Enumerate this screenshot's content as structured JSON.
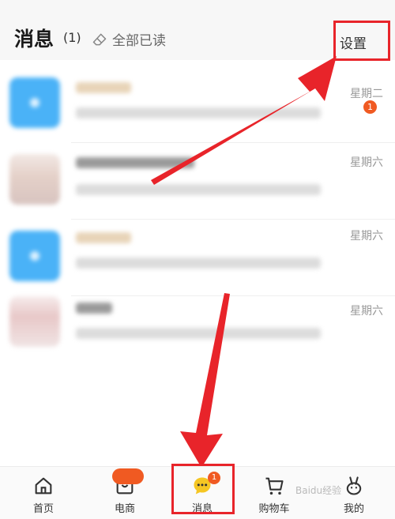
{
  "header": {
    "title": "消息",
    "count": "(1)",
    "mark_all_read": "全部已读",
    "settings": "设置"
  },
  "messages": [
    {
      "time": "星期二",
      "badge": "1"
    },
    {
      "time": "星期六",
      "badge": ""
    },
    {
      "time": "星期六",
      "badge": ""
    },
    {
      "time": "星期六",
      "badge": ""
    }
  ],
  "tabs": [
    {
      "label": "首页",
      "icon": "home-icon"
    },
    {
      "label": "电商",
      "icon": "shop-icon"
    },
    {
      "label": "消息",
      "icon": "message-icon",
      "badge": "1"
    },
    {
      "label": "购物车",
      "icon": "cart-icon"
    },
    {
      "label": "我的",
      "icon": "profile-icon"
    }
  ],
  "watermark": "Baidu经验",
  "colors": {
    "annotation_red": "#e8242a",
    "badge_orange": "#f05a22",
    "message_yellow": "#f5c623",
    "avatar_blue": "#4ab2f7"
  }
}
